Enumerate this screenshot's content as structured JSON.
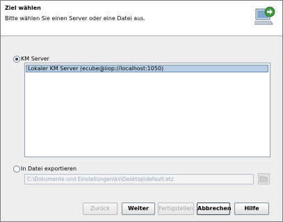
{
  "header": {
    "title": "Ziel wählen",
    "subtitle": "Bitte wählen Sie einen Server oder eine Datei aus.",
    "icon": "computer-export-icon"
  },
  "options": {
    "km_server": {
      "label": "KM Server",
      "selected": true
    },
    "file_export": {
      "label": "In Datei exportieren",
      "selected": false
    }
  },
  "server_list": {
    "items": [
      "Lokaler KM Server (ecube@iiop://localhost:1050)"
    ]
  },
  "file": {
    "path": "C:\\Dokumente und Einstellungen\\ks\\Desktop\\default.etz"
  },
  "buttons": {
    "back": "Zurück",
    "next": "Weiter",
    "finish": "Fertigstellen",
    "cancel": "Abbrechen",
    "help": "Hilfe"
  }
}
